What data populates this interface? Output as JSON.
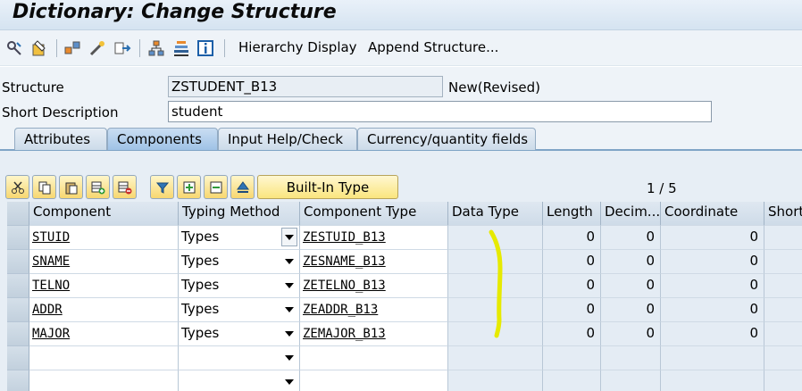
{
  "window": {
    "title": "Dictionary: Change Structure"
  },
  "toolbar": {
    "hierarchy_label": "Hierarchy Display",
    "append_label": "Append Structure...",
    "icons": [
      "other-object-icon",
      "display-change-icon",
      "activate-icon",
      "check-icon",
      "where-used-icon",
      "hierarchy-icon",
      "stack-icon",
      "info-icon"
    ]
  },
  "header": {
    "structure_label": "Structure",
    "structure_value": "ZSTUDENT_B13",
    "status": "New(Revised)",
    "short_desc_label": "Short Description",
    "short_desc_value": "student"
  },
  "tabs": [
    {
      "label": "Attributes",
      "active": false
    },
    {
      "label": "Components",
      "active": true
    },
    {
      "label": "Input Help/Check",
      "active": false
    },
    {
      "label": "Currency/quantity fields",
      "active": false
    }
  ],
  "grid_toolbar": {
    "builtin_label": "Built-In Type",
    "pager": "1 / 5"
  },
  "grid": {
    "columns": [
      "Component",
      "Typing Method",
      "Component Type",
      "Data Type",
      "Length",
      "Decim...",
      "Coordinate",
      "Short"
    ],
    "rows": [
      {
        "component": "STUID",
        "typing": "Types",
        "ctype": "ZESTUID_B13",
        "dtype": "",
        "length": "0",
        "decimals": "0",
        "coord": "0",
        "short": ""
      },
      {
        "component": "SNAME",
        "typing": "Types",
        "ctype": "ZESNAME_B13",
        "dtype": "",
        "length": "0",
        "decimals": "0",
        "coord": "0",
        "short": ""
      },
      {
        "component": "TELNO",
        "typing": "Types",
        "ctype": "ZETELNO_B13",
        "dtype": "",
        "length": "0",
        "decimals": "0",
        "coord": "0",
        "short": ""
      },
      {
        "component": "ADDR",
        "typing": "Types",
        "ctype": "ZEADDR_B13",
        "dtype": "",
        "length": "0",
        "decimals": "0",
        "coord": "0",
        "short": ""
      },
      {
        "component": "MAJOR",
        "typing": "Types",
        "ctype": "ZEMAJOR_B13",
        "dtype": "",
        "length": "0",
        "decimals": "0",
        "coord": "0",
        "short": ""
      },
      {
        "component": "",
        "typing": "",
        "ctype": "",
        "dtype": "",
        "length": "",
        "decimals": "",
        "coord": "",
        "short": ""
      },
      {
        "component": "",
        "typing": "",
        "ctype": "",
        "dtype": "",
        "length": "",
        "decimals": "",
        "coord": "",
        "short": ""
      }
    ]
  },
  "colors": {
    "title_bg": "#d5e3f1",
    "toolbar_bg": "#eef3f8",
    "active_tab": "#9fc2e6",
    "button_yellow": "#fae57e",
    "highlight_mark": "#e6ea00"
  }
}
